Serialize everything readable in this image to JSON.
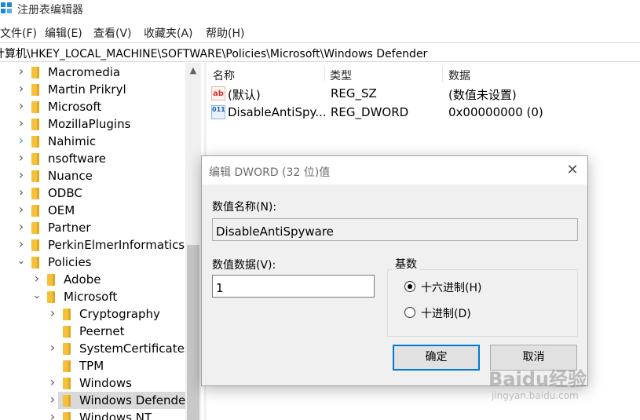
{
  "window": {
    "title": "注册表编辑器"
  },
  "menu": [
    "文件(F)",
    "编辑(E)",
    "查看(V)",
    "收藏夹(A)",
    "帮助(H)"
  ],
  "address": "计算机\\HKEY_LOCAL_MACHINE\\SOFTWARE\\Policies\\Microsoft\\Windows Defender",
  "tree": [
    {
      "label": "Macromedia",
      "state": "collapsed",
      "depth": 0
    },
    {
      "label": "Martin Prikryl",
      "state": "collapsed",
      "depth": 0
    },
    {
      "label": "Microsoft",
      "state": "collapsed",
      "depth": 0
    },
    {
      "label": "MozillaPlugins",
      "state": "collapsed",
      "depth": 0
    },
    {
      "label": "Nahimic",
      "state": "collapsed",
      "depth": 0
    },
    {
      "label": "nsoftware",
      "state": "collapsed",
      "depth": 0
    },
    {
      "label": "Nuance",
      "state": "collapsed",
      "depth": 0
    },
    {
      "label": "ODBC",
      "state": "collapsed",
      "depth": 0
    },
    {
      "label": "OEM",
      "state": "collapsed",
      "depth": 0
    },
    {
      "label": "Partner",
      "state": "collapsed",
      "depth": 0
    },
    {
      "label": "PerkinElmerInformatics",
      "state": "collapsed",
      "depth": 0
    },
    {
      "label": "Policies",
      "state": "expanded",
      "depth": 0
    },
    {
      "label": "Adobe",
      "state": "collapsed",
      "depth": 1
    },
    {
      "label": "Microsoft",
      "state": "expanded",
      "depth": 1
    },
    {
      "label": "Cryptography",
      "state": "collapsed",
      "depth": 2
    },
    {
      "label": "Peernet",
      "state": "none",
      "depth": 2
    },
    {
      "label": "SystemCertificates",
      "state": "collapsed",
      "depth": 2
    },
    {
      "label": "TPM",
      "state": "none",
      "depth": 2
    },
    {
      "label": "Windows",
      "state": "collapsed",
      "depth": 2
    },
    {
      "label": "Windows Defende",
      "state": "collapsed",
      "depth": 2,
      "selected": true
    },
    {
      "label": "Windows NT",
      "state": "collapsed",
      "depth": 2
    }
  ],
  "list": {
    "columns": [
      "名称",
      "类型",
      "数据"
    ],
    "rows": [
      {
        "icon": "ab",
        "name": "(默认)",
        "type": "REG_SZ",
        "data": "(数值未设置)"
      },
      {
        "icon": "011",
        "name": "DisableAntiSpy...",
        "type": "REG_DWORD",
        "data": "0x00000000 (0)"
      }
    ]
  },
  "dialog": {
    "title": "编辑 DWORD (32 位)值",
    "close_glyph": "✕",
    "name_label": "数值名称(N):",
    "name_value": "DisableAntiSpyware",
    "data_label": "数值数据(V):",
    "data_value": "1",
    "base_label": "基数",
    "hex_label": "十六进制(H)",
    "dec_label": "十进制(D)",
    "selected_base": "hex",
    "ok_label": "确定",
    "cancel_label": "取消"
  },
  "watermark": {
    "main": "Baidu经验",
    "sub": "jingyan.baidu.com"
  },
  "colors": {
    "folder": "#f5c13b",
    "selection": "#d9d9d9",
    "dialog_bg": "#f0f0f0",
    "accent": "#0078d7"
  }
}
